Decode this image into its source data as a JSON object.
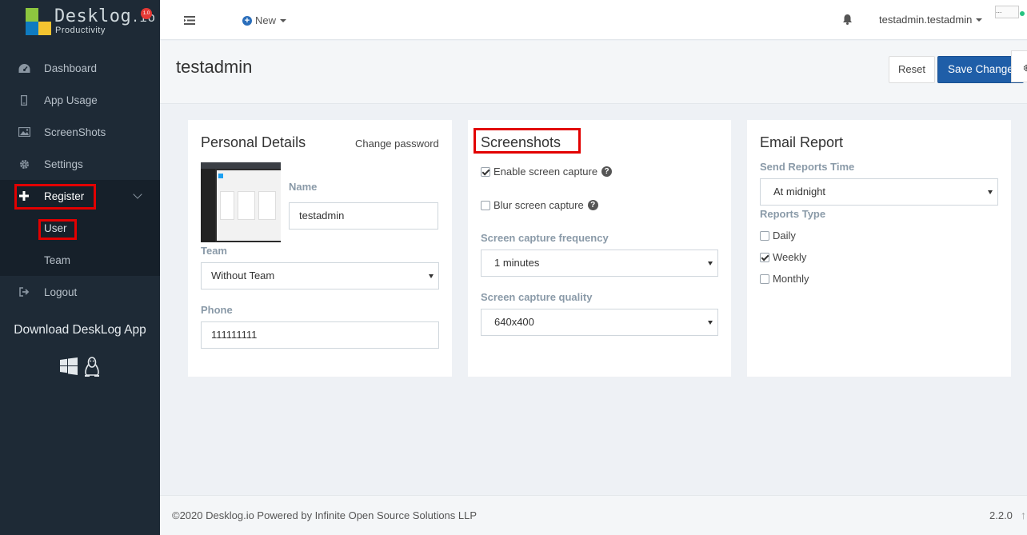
{
  "brand": {
    "name": "Desklog",
    "tld": ".io",
    "tagline": "Productivity",
    "badge": "1.0"
  },
  "sidebar": {
    "items": [
      {
        "label": "Dashboard",
        "icon": "dashboard-icon"
      },
      {
        "label": "App Usage",
        "icon": "mobile-icon"
      },
      {
        "label": "ScreenShots",
        "icon": "image-icon"
      },
      {
        "label": "Settings",
        "icon": "gear-icon"
      },
      {
        "label": "Register",
        "icon": "plus-icon"
      },
      {
        "label": "User"
      },
      {
        "label": "Team"
      },
      {
        "label": "Logout",
        "icon": "logout-icon"
      }
    ],
    "download_label": "Download DeskLog App"
  },
  "topbar": {
    "new_label": "New",
    "username": "testadmin.testadmin",
    "avatar_alt": "..."
  },
  "page": {
    "title": "testadmin",
    "reset_label": "Reset",
    "save_label": "Save Changes"
  },
  "personal": {
    "title": "Personal Details",
    "change_password": "Change password",
    "name_label": "Name",
    "name_value": "testadmin",
    "team_label": "Team",
    "team_value": "Without Team",
    "phone_label": "Phone",
    "phone_value": "111111111"
  },
  "screenshots": {
    "title": "Screenshots",
    "enable_label": "Enable screen capture",
    "enable_checked": true,
    "blur_label": "Blur screen capture",
    "blur_checked": false,
    "frequency_label": "Screen capture frequency",
    "frequency_value": "1 minutes",
    "quality_label": "Screen capture quality",
    "quality_value": "640x400"
  },
  "email": {
    "title": "Email Report",
    "send_time_label": "Send Reports Time",
    "send_time_value": "At midnight",
    "type_label": "Reports Type",
    "types": [
      {
        "label": "Daily",
        "checked": false
      },
      {
        "label": "Weekly",
        "checked": true
      },
      {
        "label": "Monthly",
        "checked": false
      }
    ]
  },
  "footer": {
    "copyright": "©2020 Desklog.io Powered by Infinite Open Source Solutions LLP",
    "version": "2.2.0"
  },
  "colors": {
    "sidebar": "#1e2a36",
    "primary": "#1f5ea8",
    "highlight": "#e20000"
  }
}
